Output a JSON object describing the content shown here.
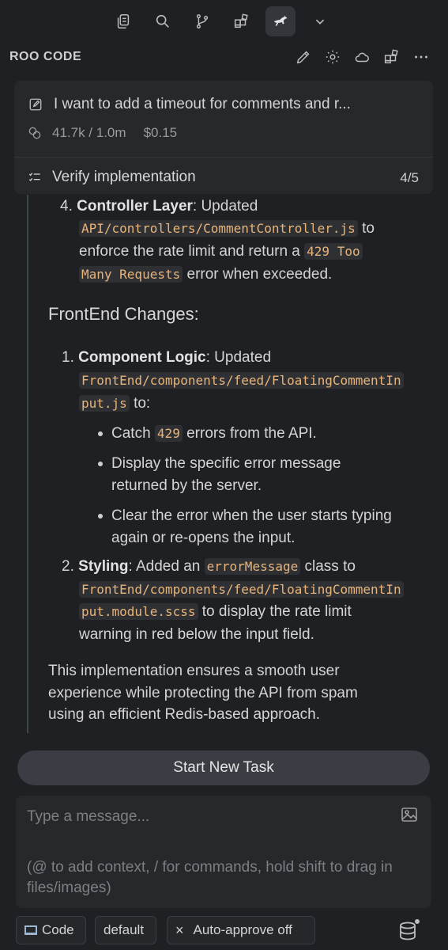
{
  "app_title": "ROO CODE",
  "topbar": {
    "icons": [
      "copy-icon",
      "search-icon",
      "source-control-icon",
      "extensions-icon",
      "kangaroo-icon",
      "chevron-down-icon"
    ],
    "active": "kangaroo-icon"
  },
  "task": {
    "title": "I want to add a timeout for comments and r...",
    "tokens": "41.7k / 1.0m",
    "cost": "$0.15",
    "todo_label": "Verify implementation",
    "todo_count": "4/5"
  },
  "content": {
    "item4": {
      "number": "4.",
      "bold": "Controller Layer",
      "text1": ": Updated",
      "code1": "API/controllers/CommentController.js",
      "text2": "to",
      "text3": "enforce the rate limit and return a",
      "code2a": "429 Too",
      "code2b": "Many Requests",
      "text4": "error when exceeded."
    },
    "heading": "FrontEnd Changes:",
    "fe1": {
      "number": "1.",
      "bold": "Component Logic",
      "text1": ": Updated",
      "code1a": "FrontEnd/components/feed/FloatingCommentIn",
      "code1b": "put.js",
      "text2": "to:"
    },
    "bullets": {
      "b1_pre": "Catch",
      "b1_code": "429",
      "b1_post": "errors from the API.",
      "b2_l1": "Display the specific error message",
      "b2_l2": "returned by the server.",
      "b3_l1": "Clear the error when the user starts typing",
      "b3_l2": "again or re-opens the input."
    },
    "fe2": {
      "number": "2.",
      "bold": "Styling",
      "text1": ": Added an",
      "code1": "errorMessage",
      "text2": "class to",
      "code2a": "FrontEnd/components/feed/FloatingCommentIn",
      "code2b": "put.module.scss",
      "text3": "to display the rate limit",
      "text4": "warning in red below the input field."
    },
    "summary_l1": "This implementation ensures a smooth user",
    "summary_l2": "experience while protecting the API from spam",
    "summary_l3": "using an efficient Redis-based approach."
  },
  "start_button": "Start New Task",
  "input": {
    "placeholder": "Type a message...",
    "hint": "(@ to add context, / for commands, hold shift to drag in files/images)"
  },
  "bottom": {
    "mode": "Code",
    "profile": "default",
    "auto_approve": "Auto-approve off",
    "auto_approve_icon": "×"
  },
  "colors": {
    "background": "#1f2024",
    "card": "#26282c",
    "code_text": "#e8b47a",
    "button": "#3a3d43"
  }
}
